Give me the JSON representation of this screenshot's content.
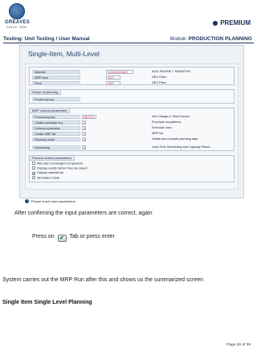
{
  "header": {
    "company": "GREAVES",
    "since": "SINCE 1859",
    "premium": "PREMIUM",
    "left": "Testing: Unit Testing / User Manual",
    "module_label": "Module:",
    "module_value": "PRODUCTION PLANNING"
  },
  "screen": {
    "title": "Single-Item, Multi-Level",
    "top_fields": [
      {
        "label": "Material",
        "value": "1411B0114820",
        "desc": "4D11 ENGINE + RADIATOR"
      },
      {
        "label": "MRP Area",
        "value": "1110",
        "desc": "DEU Plant"
      },
      {
        "label": "Plant",
        "value": "1110",
        "desc": "DEU Plant"
      }
    ],
    "scope": {
      "title": "Scope of planning",
      "field": "Product group"
    },
    "mrp": {
      "title": "MRP control parameters",
      "rows": [
        {
          "label": "Processing key",
          "value": "NETCH",
          "desc": "Net Change in Total Horizon"
        },
        {
          "label": "Create purchase req.",
          "value": "1",
          "desc": "Purchase requisitions"
        },
        {
          "label": "Delivery schedules",
          "value": "3",
          "desc": "Schedule lines"
        },
        {
          "label": "Create MRP list",
          "value": "1",
          "desc": "MRP list"
        },
        {
          "label": "Planning mode",
          "value": "3",
          "desc": "Delete and recreate planning data"
        },
        {
          "label": "Scheduling",
          "value": "2",
          "desc": "Lead Time Scheduling and Capacity Planni"
        }
      ]
    },
    "process": {
      "title": "Process control parameters",
      "options": [
        {
          "label": "Also plan unchanged components",
          "checked": false
        },
        {
          "label": "Display results before they are saved",
          "checked": false
        },
        {
          "label": "Display material list",
          "checked": true
        },
        {
          "label": "Simulation mode",
          "checked": false
        }
      ]
    },
    "status_message": "Please check input parameters"
  },
  "body": {
    "line1": "After confirming the input parameters are correct, again",
    "press_on": "Press on",
    "tab_or_enter": "Tab or press enter",
    "line3": "System carries out the MRP Run after this and shows us the summarized screen",
    "section_title": "Single Item Single Level Planning"
  },
  "footer": {
    "page": "Page 26 of 39"
  },
  "colors": {
    "brand": "#1b2f5c",
    "field_value": "#c0282a",
    "label_bg": "#dde6f0"
  }
}
